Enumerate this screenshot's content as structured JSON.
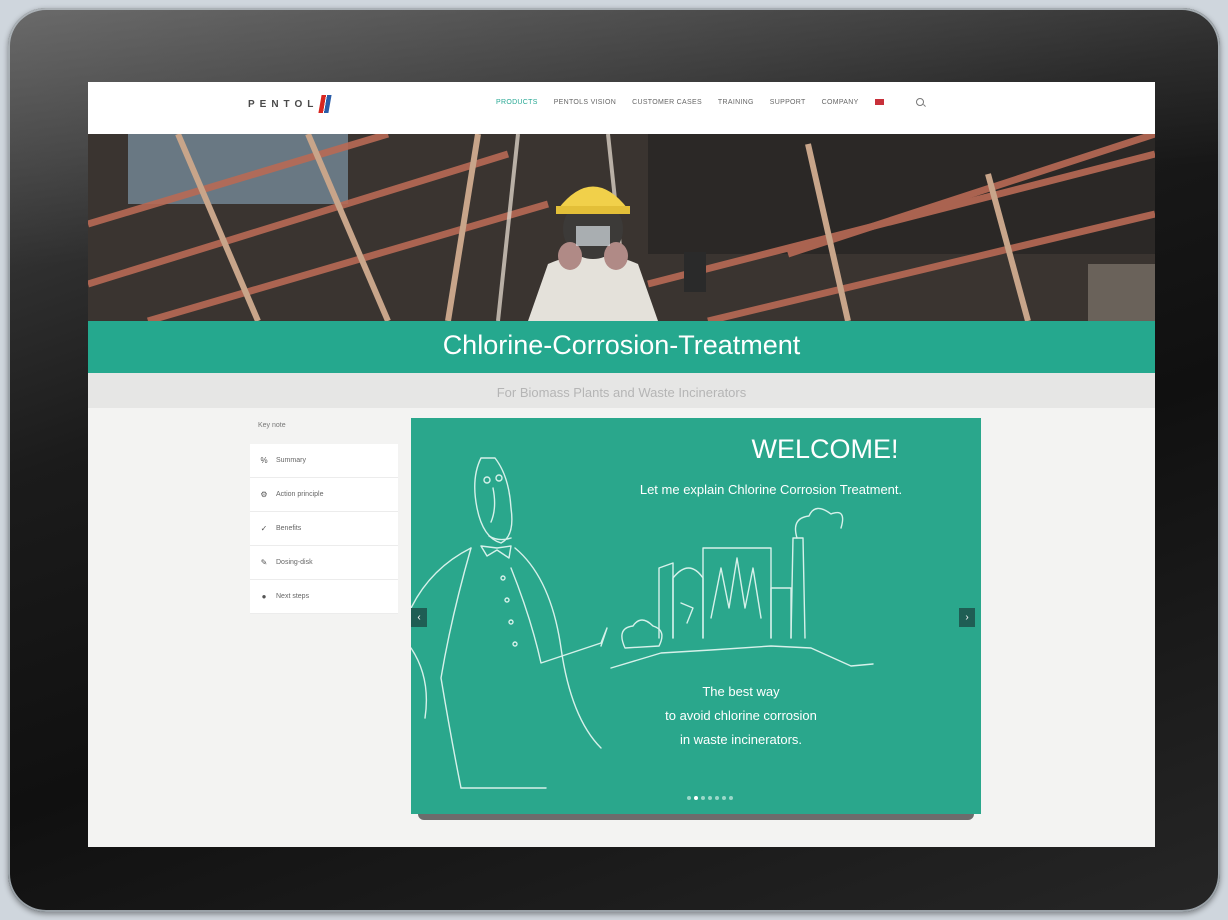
{
  "nav": {
    "logo_text": "PENTOL",
    "items": [
      {
        "label": "PRODUCTS",
        "active": true
      },
      {
        "label": "PENTOLS VISION",
        "active": false
      },
      {
        "label": "CUSTOMER CASES",
        "active": false
      },
      {
        "label": "TRAINING",
        "active": false
      },
      {
        "label": "SUPPORT",
        "active": false
      },
      {
        "label": "COMPANY",
        "active": false
      }
    ],
    "flag_icon": "flag-icon",
    "search_icon": "search-icon"
  },
  "hero": {
    "title": "Chlorine-Corrosion-Treatment",
    "subtitle": "For Biomass Plants and Waste Incinerators"
  },
  "sidebar": {
    "heading": "Key note",
    "items": [
      {
        "icon": "percent-icon",
        "label": "Summary"
      },
      {
        "icon": "gear-icon",
        "label": "Action principle"
      },
      {
        "icon": "check-icon",
        "label": "Benefits"
      },
      {
        "icon": "wrench-icon",
        "label": "Dosing-disk"
      },
      {
        "icon": "circle-icon",
        "label": "Next steps"
      }
    ]
  },
  "slide": {
    "title": "WELCOME!",
    "intro": "Let me explain Chlorine Corrosion Treatment.",
    "body_lines": [
      "The best way",
      "to avoid chlorine corrosion",
      "in waste incinerators."
    ],
    "prev_label": "‹",
    "next_label": "›",
    "dots_total": 7,
    "dots_active_index": 1
  },
  "colors": {
    "teal": "#25a88e",
    "slide_bg": "#2aa78c",
    "nav_active": "#28a894"
  }
}
